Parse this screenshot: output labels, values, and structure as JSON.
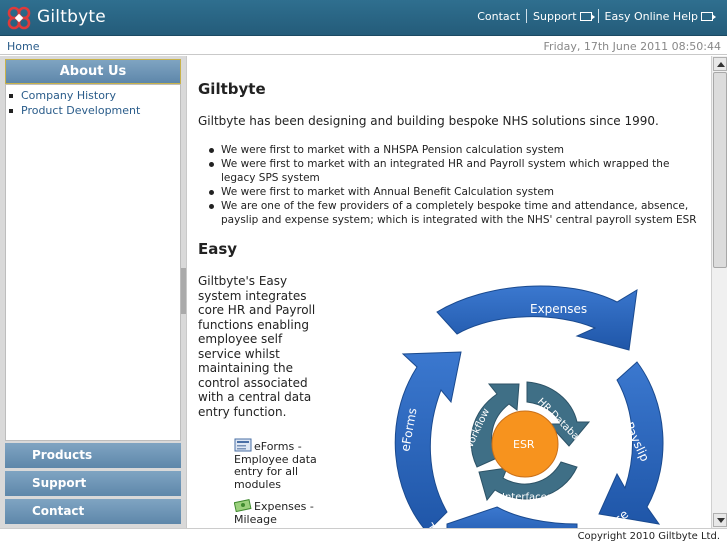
{
  "header": {
    "brand": "Giltbyte",
    "nav": [
      {
        "label": "Contact"
      },
      {
        "label": "Support"
      },
      {
        "label": "Easy Online Help"
      }
    ]
  },
  "breadcrumb": {
    "home": "Home"
  },
  "datetime": "Friday, 17th June 2011 08:50:44",
  "sidebar": {
    "active_section": "About Us",
    "sub_items": [
      "Company History",
      "Product Development"
    ],
    "sections": [
      "Products",
      "Support",
      "Contact"
    ]
  },
  "main": {
    "title": "Giltbyte",
    "intro": "Giltbyte has been designing and building bespoke NHS solutions since 1990.",
    "facts": [
      "We were first to market with a NHSPA Pension calculation system",
      "We were first to market with an integrated HR and Payroll system which wrapped the legacy SPS system",
      "We were first to market with Annual Benefit Calculation system",
      "We are one of the few providers of a completely bespoke time and attendance, absence, payslip and expense system; which is integrated with the NHS' central payroll system ESR"
    ],
    "easy_title": "Easy",
    "easy_text": "Giltbyte's Easy system integrates core HR and Payroll functions enabling employee self service whilst maintaining the control associated with a central data entry function.",
    "modules": [
      {
        "text": "eForms - Employee data entry for all modules",
        "icon": "form-icon"
      },
      {
        "text": "Expenses - Mileage",
        "icon": "money-icon"
      }
    ],
    "diagram": {
      "outer_labels": [
        "Expenses",
        "Payslip",
        "eForms",
        "Time",
        "ence"
      ],
      "inner_labels": [
        "HR Database",
        "Workflow",
        "Interfaces"
      ],
      "center": "ESR",
      "colors": {
        "outer": "#2a62b5",
        "inner": "#3f6f86",
        "center": "#f7931e"
      }
    }
  },
  "footer": {
    "copyright": "Copyright 2010 Giltbyte Ltd."
  }
}
